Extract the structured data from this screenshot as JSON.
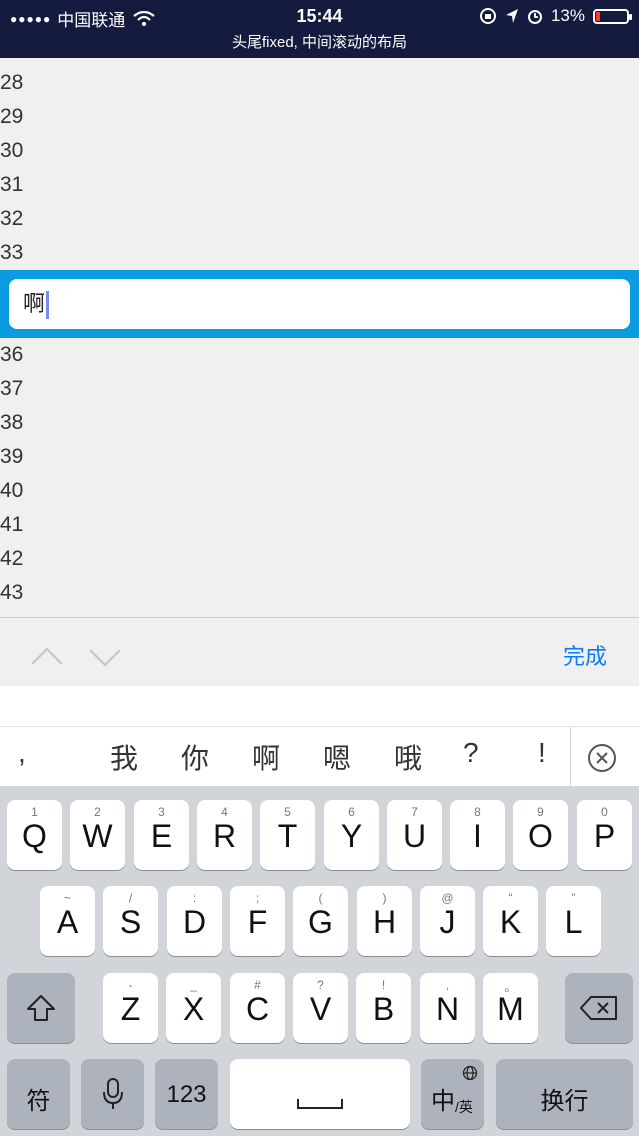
{
  "status_bar": {
    "carrier": "中国联通",
    "time": "15:44",
    "battery": "13%",
    "battery_level": 0.13,
    "icons": [
      "signal-dots",
      "wifi-icon",
      "lock-rotation-icon",
      "location-icon",
      "alarm-icon",
      "battery-icon"
    ]
  },
  "header": {
    "title": "头尾fixed, 中间滚动的布局"
  },
  "list_top": [
    "28",
    "29",
    "30",
    "31",
    "32",
    "33"
  ],
  "input": {
    "value": "啊"
  },
  "list_bottom": [
    "36",
    "37",
    "38",
    "39",
    "40",
    "41",
    "42",
    "43"
  ],
  "accessory": {
    "done_label": "完成"
  },
  "candidates": [
    ",",
    "我",
    "你",
    "啊",
    "嗯",
    "哦",
    "?",
    "!"
  ],
  "keyboard": {
    "row1": [
      {
        "main": "Q",
        "sub": "1"
      },
      {
        "main": "W",
        "sub": "2"
      },
      {
        "main": "E",
        "sub": "3"
      },
      {
        "main": "R",
        "sub": "4"
      },
      {
        "main": "T",
        "sub": "5"
      },
      {
        "main": "Y",
        "sub": "6"
      },
      {
        "main": "U",
        "sub": "7"
      },
      {
        "main": "I",
        "sub": "8"
      },
      {
        "main": "O",
        "sub": "9"
      },
      {
        "main": "P",
        "sub": "0"
      }
    ],
    "row2": [
      {
        "main": "A",
        "sub": "~"
      },
      {
        "main": "S",
        "sub": "/"
      },
      {
        "main": "D",
        "sub": ":"
      },
      {
        "main": "F",
        "sub": ";"
      },
      {
        "main": "G",
        "sub": "("
      },
      {
        "main": "H",
        "sub": ")"
      },
      {
        "main": "J",
        "sub": "@"
      },
      {
        "main": "K",
        "sub": "“"
      },
      {
        "main": "L",
        "sub": "”"
      }
    ],
    "row3": [
      {
        "main": "Z",
        "sub": "-"
      },
      {
        "main": "X",
        "sub": "_"
      },
      {
        "main": "C",
        "sub": "#"
      },
      {
        "main": "V",
        "sub": "?"
      },
      {
        "main": "B",
        "sub": "!"
      },
      {
        "main": "N",
        "sub": ","
      },
      {
        "main": "M",
        "sub": "。"
      }
    ],
    "fuhao": "符",
    "numbers": "123",
    "lang_main": "中",
    "lang_sub": "/英",
    "return": "换行"
  },
  "colors": {
    "header_bg": "#151a3f",
    "input_bar": "#0b9be0",
    "done": "#0a7cf5",
    "battery_low": "#ff3b30"
  }
}
